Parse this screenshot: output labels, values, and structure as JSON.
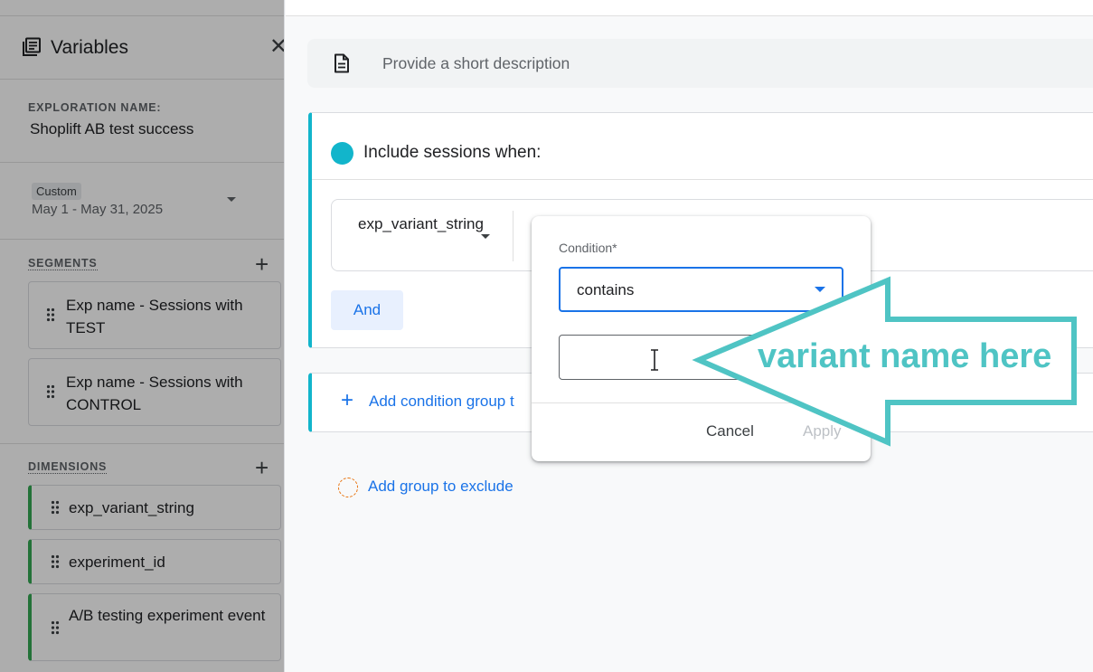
{
  "sidebar": {
    "title": "Variables",
    "close_label": "✕",
    "exploration_name_label": "EXPLORATION NAME:",
    "exploration_name": "Shoplift AB test success",
    "date_chip": "Custom",
    "date_range": "May 1 - May 31, 2025",
    "segments_label": "SEGMENTS",
    "add_label": "+",
    "segments": [
      {
        "label": "Exp name - Sessions with TEST"
      },
      {
        "label": "Exp name - Sessions with CONTROL"
      }
    ],
    "dimensions_label": "DIMENSIONS",
    "dimensions": [
      {
        "label": "exp_variant_string"
      },
      {
        "label": "experiment_id"
      },
      {
        "label": "A/B testing experiment event"
      }
    ]
  },
  "main": {
    "description_placeholder": "Provide a short description",
    "include_title": "Include sessions when:",
    "condition_dimension": "exp_variant_string",
    "and_label": "And",
    "add_condition_group": "Add condition group t",
    "add_group_exclude": "Add group to exclude",
    "plus_label": "+"
  },
  "popover": {
    "condition_label": "Condition*",
    "condition_value": "contains",
    "input_value": "",
    "cancel_label": "Cancel",
    "apply_label": "Apply"
  },
  "annotation": {
    "text": "variant name here",
    "color": "#4fc4c4"
  },
  "icons": {
    "variables": "library-books-icon",
    "description": "document-icon",
    "drag": "drag-handle-icon",
    "cursor": "text-cursor-icon"
  },
  "colors": {
    "include_accent": "#12b5cb",
    "dimension_accent": "#34a853",
    "link": "#1a73e8",
    "exclude_accent": "#e8710a"
  }
}
